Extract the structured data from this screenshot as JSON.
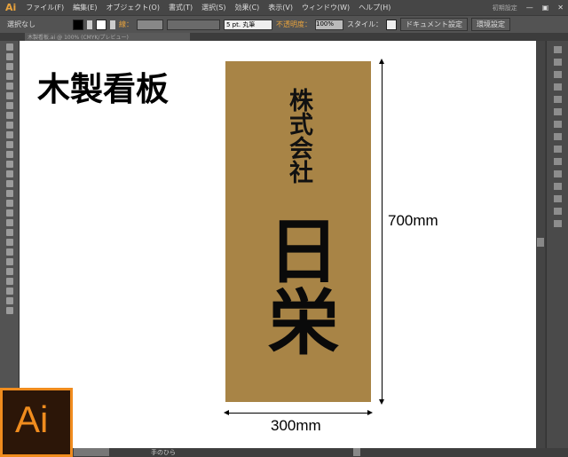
{
  "app": {
    "logo": "Ai",
    "workspace": "初期設定",
    "badge_logo": "Ai"
  },
  "menu": [
    "ファイル(F)",
    "編集(E)",
    "オブジェクト(O)",
    "書式(T)",
    "選択(S)",
    "効果(C)",
    "表示(V)",
    "ウィンドウ(W)",
    "ヘルプ(H)"
  ],
  "control": {
    "selection": "選択なし",
    "stroke_label": "線：",
    "brush": "5 pt. 丸筆",
    "opacity_label": "不透明度：",
    "opacity": "100%",
    "style_label": "スタイル：",
    "doc_setup": "ドキュメント設定",
    "prefs": "環境設定"
  },
  "doc_tab": "木製看板.ai @ 100% (CMYK/プレビュー)",
  "status": {
    "tool": "手のひら"
  },
  "artwork": {
    "title": "木製看板",
    "company": "株式会社",
    "name": "日栄",
    "height": "700mm",
    "width": "300mm",
    "board_color": "#a88446"
  }
}
